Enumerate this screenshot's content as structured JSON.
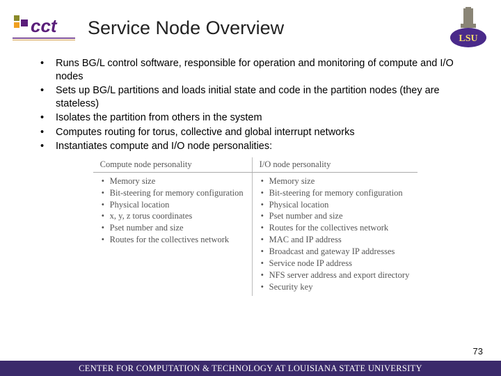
{
  "title": "Service Node Overview",
  "bullets": [
    "Runs BG/L control software, responsible for operation and monitoring of compute and I/O nodes",
    "Sets up BG/L partitions and loads initial state and code in the partition nodes (they are stateless)",
    "Isolates the partition from others in the system",
    "Computes routing for torus, collective and global interrupt networks",
    "Instantiates compute and I/O node personalities:"
  ],
  "table": {
    "headers": [
      "Compute node personality",
      "I/O node personality"
    ],
    "col1": [
      "Memory size",
      "Bit-steering for memory configuration",
      "Physical location",
      "x, y, z torus coordinates",
      "Pset number and size",
      "Routes for the collectives network"
    ],
    "col2": [
      "Memory size",
      "Bit-steering for memory configuration",
      "Physical location",
      "Pset number and size",
      "Routes for the collectives network",
      "MAC and IP address",
      "Broadcast and gateway IP addresses",
      "Service node IP address",
      "NFS server address and export directory",
      "Security key"
    ]
  },
  "page": "73",
  "footer": "CENTER FOR COMPUTATION & TECHNOLOGY AT LOUISIANA STATE UNIVERSITY"
}
